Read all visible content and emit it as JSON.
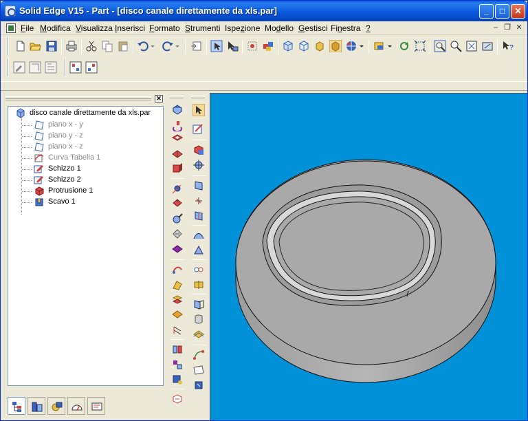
{
  "window": {
    "title": "Solid Edge V15 - Part - [disco canale direttamente da xls.par]",
    "minimize_glyph": "_",
    "maximize_glyph": "□",
    "close_glyph": "✕"
  },
  "menubar": {
    "items": [
      {
        "label": "File",
        "key": "F"
      },
      {
        "label": "Modifica",
        "key": "M"
      },
      {
        "label": "Visualizza",
        "key": "V"
      },
      {
        "label": "Inserisci",
        "key": "I"
      },
      {
        "label": "Formato",
        "key": "F"
      },
      {
        "label": "Strumenti",
        "key": "S"
      },
      {
        "label": "Ispezione",
        "key": "z"
      },
      {
        "label": "Modello",
        "key": "d"
      },
      {
        "label": "Gestisci",
        "key": "G"
      },
      {
        "label": "Finestra",
        "key": "n"
      },
      {
        "label": "?",
        "key": "?"
      }
    ],
    "mdi_minimize": "–",
    "mdi_restore": "❐",
    "mdi_close": "✕"
  },
  "feature_panel": {
    "close_glyph": "✕",
    "root": "disco canale direttamente da xls.par",
    "items": [
      {
        "label": "piano x - y",
        "icon": "plane-icon",
        "dim": true
      },
      {
        "label": "piano y - z",
        "icon": "plane-icon",
        "dim": true
      },
      {
        "label": "piano x - z",
        "icon": "plane-icon",
        "dim": true
      },
      {
        "label": "Curva Tabella 1",
        "icon": "curve-table-icon",
        "dim": true
      },
      {
        "label": "Schizzo 1",
        "icon": "sketch-icon",
        "dim": false
      },
      {
        "label": "Schizzo 2",
        "icon": "sketch-icon",
        "dim": false
      },
      {
        "label": "Protrusione 1",
        "icon": "protrusion-icon",
        "dim": false
      },
      {
        "label": "Scavo 1",
        "icon": "cutout-icon",
        "dim": false
      }
    ],
    "tabs": [
      "feature-pathfinder-icon",
      "library-icon",
      "layers-icon",
      "sensors-icon",
      "design-binder-icon"
    ]
  },
  "colors": {
    "viewport": "#0091d9",
    "part_face": "#a9a9a9",
    "part_side": "#8c8c8c",
    "title_blue": "#0b5ce0"
  }
}
